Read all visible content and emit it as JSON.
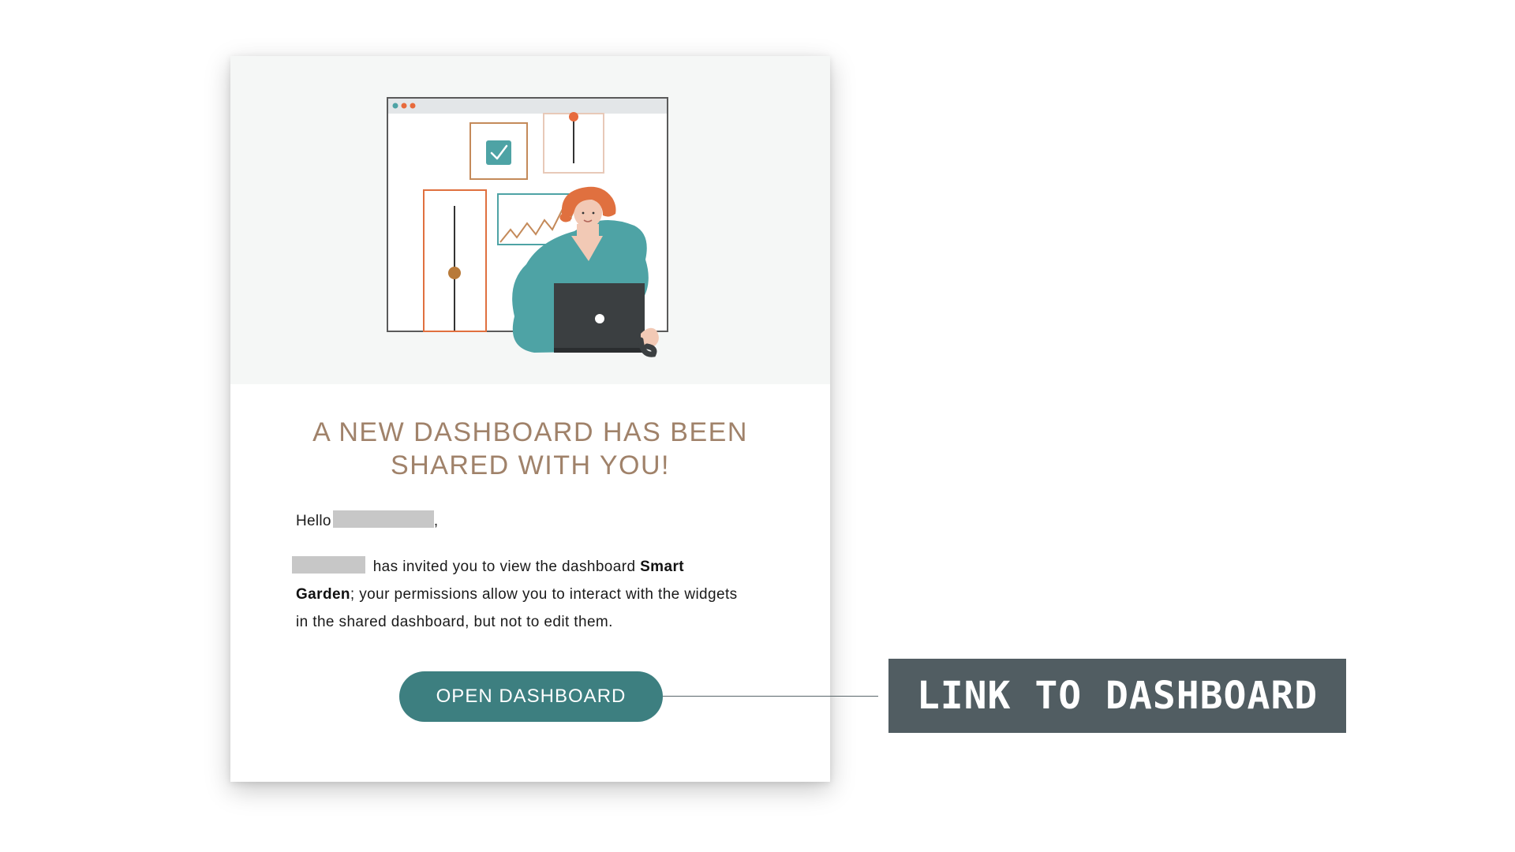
{
  "email": {
    "headline_line1": "A NEW DASHBOARD HAS BEEN",
    "headline_line2": "SHARED WITH YOU!",
    "greeting_prefix": "Hello",
    "greeting_suffix": ",",
    "body_text_1": "has invited you to view the dashboard",
    "dashboard_name": "Smart Garden",
    "body_text_2": "; your permissions allow you to interact with the widgets in the shared dashboard, but not to edit them.",
    "button_label": "OPEN DASHBOARD"
  },
  "annotation": {
    "label": "LINK TO DASHBOARD"
  },
  "colors": {
    "accent_teal": "#3d7f80",
    "headline": "#a0826a",
    "callout_bg": "#515d62",
    "hero_bg": "#f5f7f6",
    "redaction": "#c7c7c7"
  },
  "icons": [
    "browser-window-illustration",
    "checkbox-icon",
    "line-chart-illustration",
    "slider-illustration",
    "woman-with-laptop-illustration"
  ]
}
